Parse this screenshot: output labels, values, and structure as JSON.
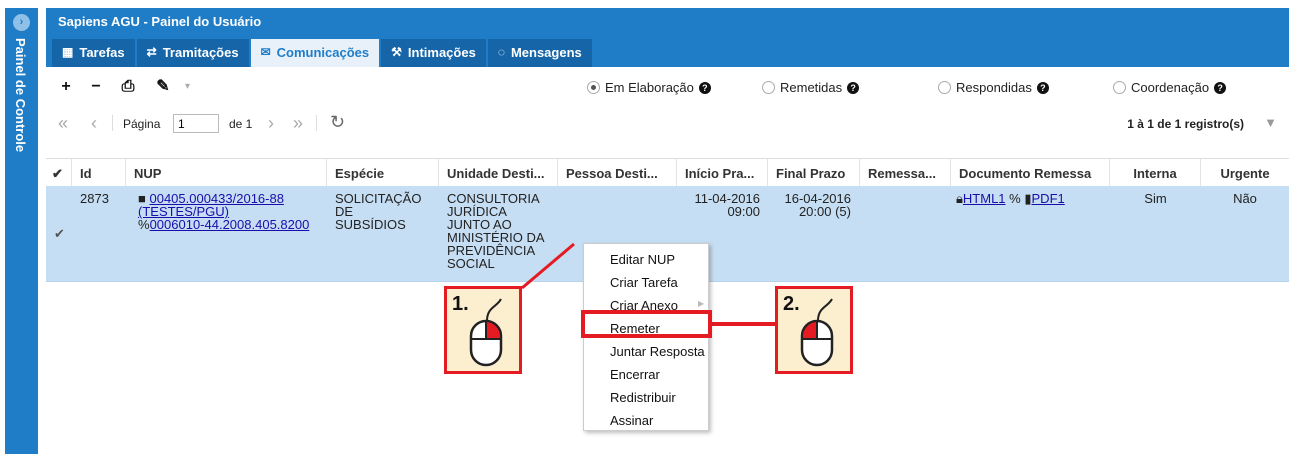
{
  "sidebar": {
    "label": "Painel de Controle",
    "toggle_icon": "arrow-right-icon"
  },
  "header": {
    "title": "Sapiens AGU - Painel do Usuário"
  },
  "tabs": [
    {
      "label": "Tarefas",
      "icon": "calendar-icon",
      "glyph": "▦"
    },
    {
      "label": "Tramitações",
      "icon": "exchange-icon",
      "glyph": "⇄"
    },
    {
      "label": "Comunicações",
      "icon": "envelope-icon",
      "glyph": "✉"
    },
    {
      "label": "Intimações",
      "icon": "gavel-icon",
      "glyph": "⚒"
    },
    {
      "label": "Mensagens",
      "icon": "comments-icon",
      "glyph": "◌"
    }
  ],
  "toolbar": {
    "add": "+",
    "remove": "−",
    "print": "⎙",
    "tools": "✎",
    "caret": "▾"
  },
  "filters": [
    {
      "label": "Em Elaboração",
      "selected": true
    },
    {
      "label": "Remetidas",
      "selected": false
    },
    {
      "label": "Respondidas",
      "selected": false
    },
    {
      "label": "Coordenação",
      "selected": false
    }
  ],
  "pager": {
    "first": "«",
    "prev": "‹",
    "page_label": "Página",
    "page_value": "1",
    "of_label": "de 1",
    "next": "›",
    "last": "»",
    "refresh": "↻",
    "count": "1 à 1 de 1 registro(s)",
    "filter_icon": "filter-icon"
  },
  "columns": [
    "Id",
    "NUP",
    "Espécie",
    "Unidade Desti...",
    "Pessoa Desti...",
    "Início Pra...",
    "Final Prazo",
    "Remessa...",
    "Documento Remessa",
    "Interna",
    "Urgente"
  ],
  "row": {
    "id": "2873",
    "nup_main": "00405.000433/2016-88",
    "nup_sub": "(TESTES/PGU)",
    "nup_link": "0006010-44.2008.405.8200",
    "especie": [
      "SOLICITAÇÃO",
      "DE",
      "SUBSÍDIOS"
    ],
    "unidade": [
      "CONSULTORIA",
      "JURÍDICA",
      "JUNTO AO",
      "MINISTÉRIO DA",
      "PREVIDÊNCIA",
      "SOCIAL"
    ],
    "inicio": [
      "11-04-2016",
      "09:00"
    ],
    "final": [
      "16-04-2016",
      "20:00 (5)"
    ],
    "doc_html": "HTML1",
    "doc_pdf": "PDF1",
    "interna": "Sim",
    "urgente": "Não"
  },
  "context_menu": [
    "Editar NUP",
    "Criar Tarefa",
    "Criar Anexo",
    "Remeter",
    "Juntar Resposta",
    "Encerrar",
    "Redistribuir",
    "Assinar"
  ],
  "annotations": {
    "step1": "1.",
    "step2": "2.",
    "accent": "#e41b23"
  },
  "colors": {
    "brand": "#1f7dc8",
    "selected_row": "#c6def3"
  }
}
